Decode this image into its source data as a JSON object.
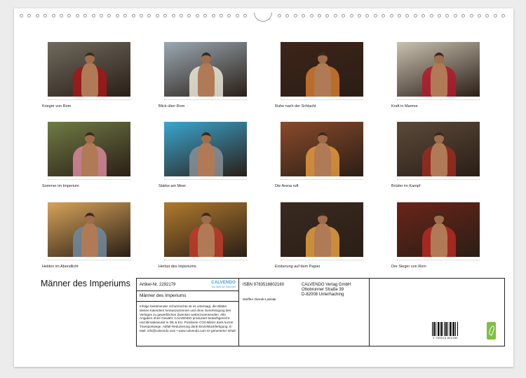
{
  "calendar": {
    "title": "Männer des Imperiums",
    "months": [
      {
        "caption": "Krieger von Rom",
        "bg": "#6f6a5e",
        "accent": "#a4161a"
      },
      {
        "caption": "Blick über Rom",
        "bg": "#9aa9b3",
        "accent": "#eae6d8"
      },
      {
        "caption": "Ruhe nach der Schlacht",
        "bg": "#3d2418",
        "accent": "#d47a2c"
      },
      {
        "caption": "Kraft in Marmor",
        "bg": "#c9c1b0",
        "accent": "#b3172c"
      },
      {
        "caption": "Sommer im Imperium",
        "bg": "#6f7b44",
        "accent": "#d9889d"
      },
      {
        "caption": "Stärke am Meer",
        "bg": "#3aa6d0",
        "accent": "#8a8f95"
      },
      {
        "caption": "Die Arena ruft",
        "bg": "#8a4a2a",
        "accent": "#e49a3c"
      },
      {
        "caption": "Brüder im Kampf",
        "bg": "#5b4a3a",
        "accent": "#9b2a1f"
      },
      {
        "caption": "Helden im Abendlicht",
        "bg": "#d6a35a",
        "accent": "#6d8aa0"
      },
      {
        "caption": "Herbst des Imperiums",
        "bg": "#b07a2e",
        "accent": "#c0392b"
      },
      {
        "caption": "Eroberung auf dem Papier",
        "bg": "#3a2a20",
        "accent": "#e8a040"
      },
      {
        "caption": "Der Sieger von Rom",
        "bg": "#6a2418",
        "accent": "#b52a22"
      }
    ]
  },
  "info_box": {
    "article_no": "Artikel-Nr. 2292179",
    "publisher_logo": {
      "name": "CALVENDO",
      "tagline": "Die Welt der Kalender"
    },
    "product_title": "Männer des Imperiums",
    "legal_text": "Infolge bestehender Schutzrechte ist es untersagt, die Blätter dieses Kalenders herauszutrennen und ohne Genehmigung des Verlages zu gewerblichen Zwecken weiterzuverwenden. Alle Angaben ohne Gewähr. CALVENDO produziert bedarfsgerecht und klimabewusst in DE & EU. Positivere CO2-Bilanz dank kurzer Transportwege. Abfall-Reduzierung dank Einzelstückfertigung. E-Mail: info@calvendo.com • www.calvendo.com KI-generierter Inhalt",
    "isbn": "ISBN 9783516802160",
    "author": "Steffen Gierok-Latniak",
    "publisher_name": "CALVENDO Verlag GmbH",
    "publisher_street": "Ottobrunner Straße 39",
    "publisher_city": "D-82008 Unterhaching",
    "ean": "9 783516 802160"
  },
  "colors": {
    "eco_label": "#7fbf3f",
    "logo_blue": "#3aa2d6"
  }
}
